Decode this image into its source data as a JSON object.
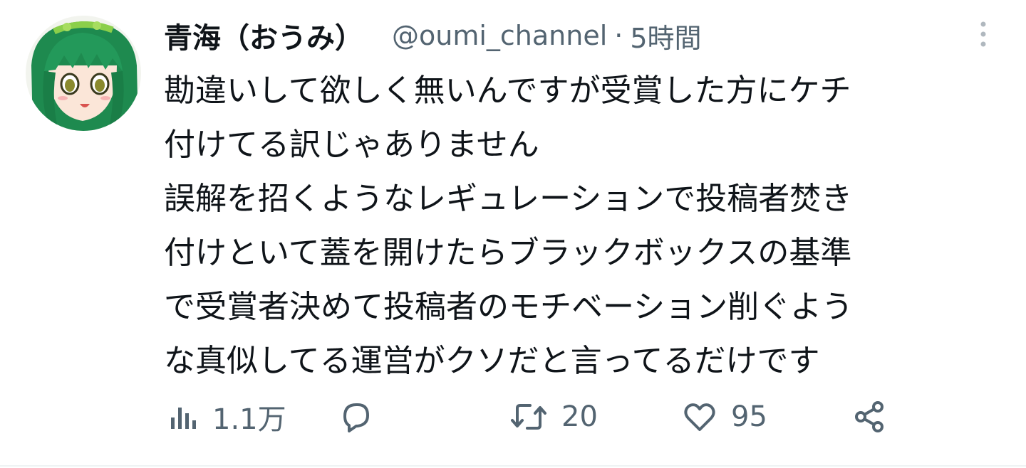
{
  "tweet": {
    "author": {
      "display_name": "青海（おうみ）",
      "handle": "@oumi_channel",
      "separator": "·",
      "time": "5時間"
    },
    "text_lines": [
      "勘違いして欲しく無いんですが受賞した方にケチ",
      "付けてる訳じゃありません",
      "誤解を招くようなレギュレーションで投稿者焚き",
      "付けといて蓋を開けたらブラックボックスの基準",
      "で受賞者決めて投稿者のモチベーション削ぐよう",
      "な真似してる運営がクソだと言ってるだけです"
    ],
    "actions": {
      "views": {
        "icon": "views-icon",
        "count": "1.1万"
      },
      "reply": {
        "icon": "reply-icon",
        "count": ""
      },
      "retweet": {
        "icon": "retweet-icon",
        "count": "20"
      },
      "like": {
        "icon": "heart-icon",
        "count": "95"
      },
      "share": {
        "icon": "share-icon"
      }
    },
    "more_icon": "more-vertical-icon"
  },
  "colors": {
    "text": "#0f1419",
    "secondary": "#536471",
    "avatar_hair": "#1e8a4f",
    "divider": "#eff3f4"
  }
}
